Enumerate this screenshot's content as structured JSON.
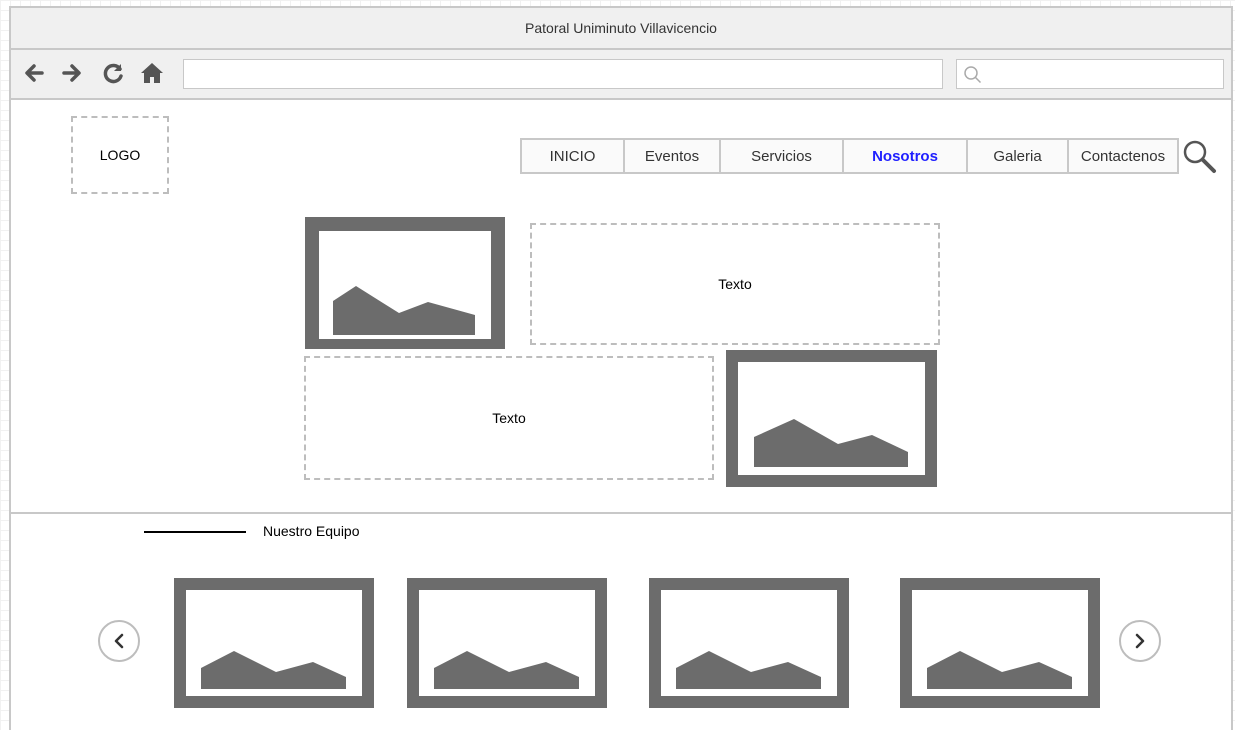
{
  "window": {
    "title": "Patoral Uniminuto Villavicencio"
  },
  "browser": {
    "url_value": "",
    "search_value": "",
    "icons": [
      "back-arrow-icon",
      "forward-arrow-icon",
      "refresh-icon",
      "home-icon",
      "search-icon"
    ]
  },
  "header": {
    "logo_text": "LOGO",
    "nav": [
      "INICIO",
      "Eventos",
      "Servicios",
      "Nosotros",
      "Galeria",
      "Contactenos"
    ],
    "active_nav": "Nosotros"
  },
  "content": {
    "text_block_1": "Texto",
    "text_block_2": "Texto"
  },
  "team": {
    "title": "Nuestro Equipo",
    "member_count_visible": 4
  },
  "colors": {
    "frame_border": "#c8c8c8",
    "chrome_bg": "#f0f0f0",
    "placeholder_gray": "#6c6c6c",
    "active_link": "#1f1fff"
  }
}
